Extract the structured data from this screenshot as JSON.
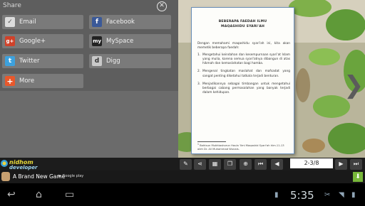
{
  "share": {
    "title": "Share",
    "items": [
      {
        "label": "Email",
        "icon": "envelope-icon",
        "icon_char": "✓",
        "icon_bg": "#dcdcdc"
      },
      {
        "label": "Facebook",
        "icon": "facebook-icon",
        "icon_char": "f",
        "icon_bg": "#3b5998"
      },
      {
        "label": "Google+",
        "icon": "google-plus-icon",
        "icon_char": "g+",
        "icon_bg": "#d0422a"
      },
      {
        "label": "MySpace",
        "icon": "myspace-icon",
        "icon_char": "my",
        "icon_bg": "#222222"
      },
      {
        "label": "Twitter",
        "icon": "twitter-icon",
        "icon_char": "t",
        "icon_bg": "#3da1dd"
      },
      {
        "label": "Digg",
        "icon": "digg-icon",
        "icon_char": "d",
        "icon_bg": "#c9c9c9"
      },
      {
        "label": "More",
        "icon": "plus-icon",
        "icon_char": "+",
        "icon_bg": "#e8582c"
      }
    ]
  },
  "book": {
    "title_line1": "BEBERAPA FAEDAH ILMU",
    "title_line2": "MAQASHIDU SYARI'AH",
    "intro": "Dengan memahami maqashidu syari'ah ini, kita akan memetik beberapa faedah:",
    "points": [
      {
        "num": "1.",
        "text": "Mengetahui keindahan dan kesempurnaan syari'at Islam yang mulia, karena semua syari'atnya dibangun di atas hikmah dan kemaslahatan bagi hamba."
      },
      {
        "num": "2.",
        "text": "Mengenal tingkatan maslahat dan mafsadat yang sangat penting diketahui tatkala terjadi benturan."
      },
      {
        "num": "3.",
        "text": "Menjadikannya sebagai timbangan untuk mengetahui berbagai cabang permasalahan yang banyak terjadi dalam kehidupan."
      }
    ],
    "footnote_num": "1",
    "footnote": "Bahtsun Mukhtashorun Haula 'Ilmi Maqashid Syari'ah hlm.11-13 oleh Dr. Ali Muhammad Wunais."
  },
  "toolbar": {
    "page_indicator": "2-3/8",
    "buttons": [
      "highlight-icon",
      "share-icon",
      "grid-icon",
      "pages-icon",
      "zoom-icon",
      "first-page-icon",
      "prev-page-icon",
      "next-page-icon",
      "last-page-icon"
    ]
  },
  "brand": {
    "line1": "nidhom",
    "line2": "developer"
  },
  "ad": {
    "title": "A Brand New Game",
    "badge": "Google play"
  },
  "status": {
    "time": "5:35"
  },
  "colors": {
    "toolbar": "#1c1c1c",
    "panel": "#5e5e5e",
    "page_border": "#6a8fb8"
  }
}
